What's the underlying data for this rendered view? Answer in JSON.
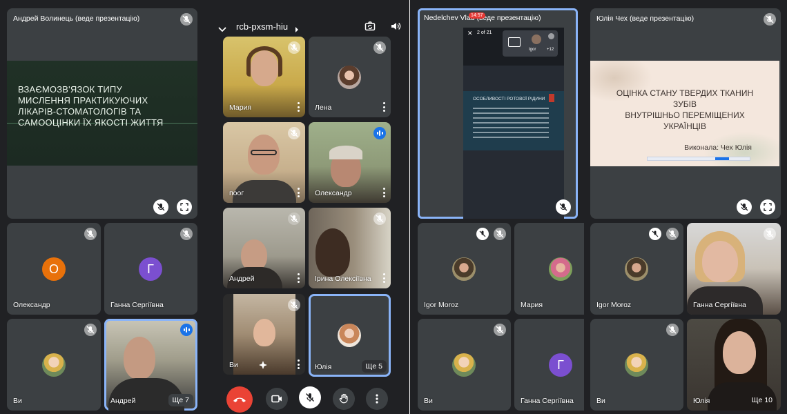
{
  "panel1": {
    "presenter_title": "Андрей Волинець (веде презентацію)",
    "slide_title": "ВЗАЄМОЗВ'ЯЗОК ТИПУ\nМИСЛЕННЯ ПРАКТИКУЮЧИХ\nЛІКАРІВ-СТОМАТОЛОГІВ ТА\nСАМООЦІНКИ ЇХ ЯКОСТІ ЖИТТЯ",
    "tiles": [
      {
        "name": "Олександр",
        "initial": "О",
        "color": "#e8710a"
      },
      {
        "name": "Ганна Сергіївна",
        "initial": "Г",
        "color": "#7b4fd0"
      },
      {
        "name": "Ви"
      },
      {
        "name": "Андрей",
        "more_label": "Ще 7"
      }
    ]
  },
  "panel2": {
    "meeting_code": "rcb-pxsm-hiu",
    "tiles": [
      {
        "name": "Мария"
      },
      {
        "name": "Лена"
      },
      {
        "name": "поог"
      },
      {
        "name": "Олександр"
      },
      {
        "name": "Андрей"
      },
      {
        "name": "Ірина Олексіївна"
      },
      {
        "name": "Ви"
      },
      {
        "name": "Юлія",
        "more_label": "Ще 5"
      }
    ],
    "colors": {
      "end_call": "#ea4335",
      "accent": "#1a73e8"
    }
  },
  "panel3": {
    "presenter_title": "Nedelchev Vlad (веде презентацію)",
    "page_counter": "2 of 21",
    "recording_time": "14:57",
    "overlay_name": "Igor",
    "overlay_count": "+12",
    "slide_header": "ОСОБЛИВОСТІ РОТОВОЇ РІДИНИ",
    "tiles": [
      {
        "name": "Igor Moroz"
      },
      {
        "name": "Мария"
      },
      {
        "name": "Ви"
      },
      {
        "name": "Ганна Сергіївна",
        "initial": "Г",
        "color": "#7b4fd0"
      }
    ]
  },
  "panel4": {
    "presenter_title": "Юлія Чех (веде презентацію)",
    "slide_title": "ОЦІНКА СТАНУ ТВЕРДИХ ТКАНИН\nЗУБІВ\nВНУТРІШНЬО ПЕРЕМІЩЕНИХ\nУКРАЇНЦІВ",
    "slide_author": "Виконала: Чех Юлія",
    "tiles": [
      {
        "name": "Igor Moroz"
      },
      {
        "name": "Ганна Сергіївна"
      },
      {
        "name": "Ви"
      },
      {
        "name": "Юлія",
        "more_label": "Ще 10"
      }
    ]
  }
}
